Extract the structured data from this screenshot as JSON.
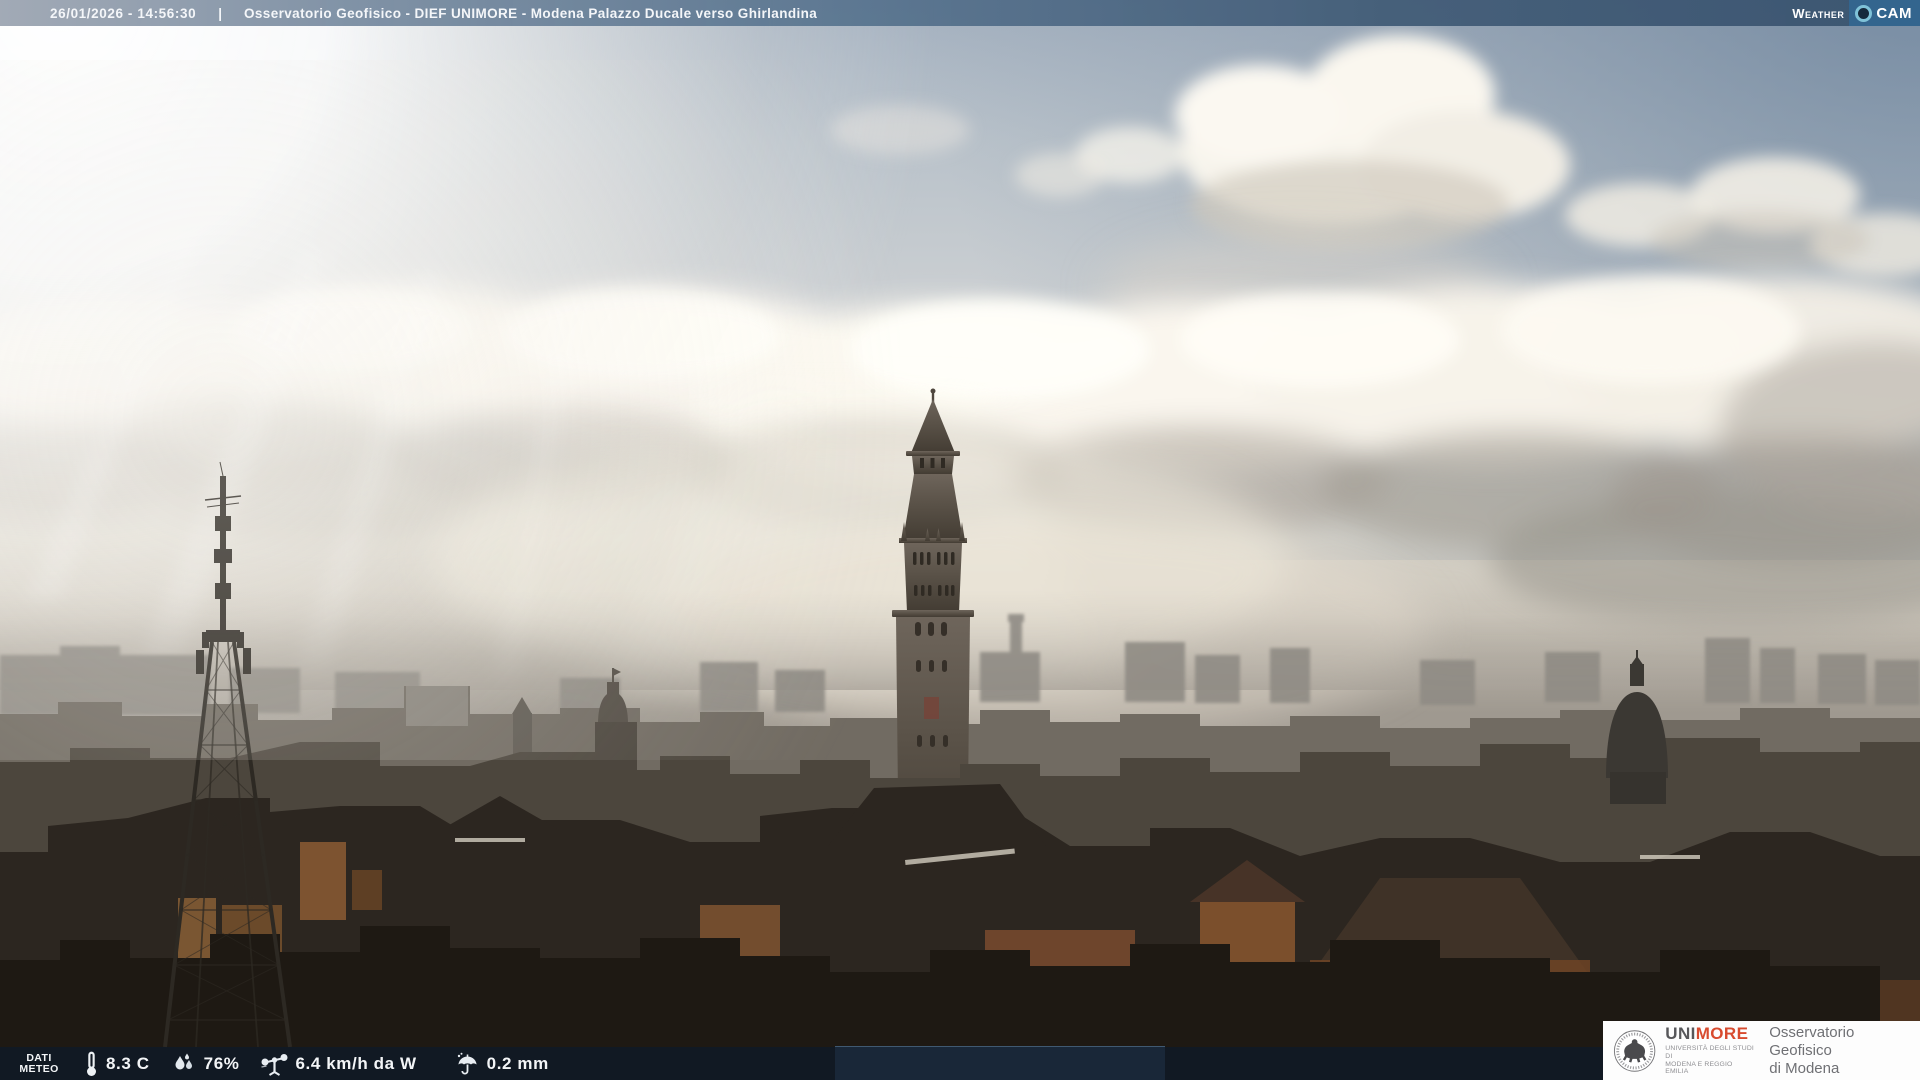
{
  "topbar": {
    "datetime": "26/01/2026 - 14:56:30",
    "separator": "|",
    "title": "Osservatorio Geofisico - DIEF UNIMORE - Modena Palazzo Ducale verso Ghirlandina",
    "logo": {
      "weather": "Weather",
      "cam": "CAM",
      "lens_icon": "camera-lens-icon"
    }
  },
  "meteo_bar": {
    "label_line1": "DATI",
    "label_line2": "METEO",
    "readings": [
      {
        "name": "temperature",
        "icon": "thermometer-icon",
        "value": "8.3 C"
      },
      {
        "name": "humidity",
        "icon": "humidity-drops-icon",
        "value": "76%"
      },
      {
        "name": "wind",
        "icon": "anemometer-icon",
        "value": "6.4 km/h da W"
      },
      {
        "name": "rain",
        "icon": "umbrella-rain-icon",
        "value": "0.2 mm"
      }
    ]
  },
  "branding": {
    "seal_icon": "unimore-seal-icon",
    "wordmark_uni": "UNI",
    "wordmark_more": "MORE",
    "university_line1": "UNIVERSITÀ DEGLI STUDI DI",
    "university_line2": "MODENA E REGGIO EMILIA",
    "org_line1": "Osservatorio Geofisico",
    "org_line2": "di Modena"
  },
  "scene": {
    "description": "Backlit afternoon webcam view over Modena rooftops toward the Ghirlandina tower, telecom lattice mast at left, cumulus band and sun glare at top left",
    "landmarks": [
      "antenna-tower",
      "ghirlandina-tower",
      "church-dome-left",
      "church-dome-right"
    ]
  },
  "colors": {
    "topbar_left": "#9aa3b0",
    "topbar_right": "#3a5470",
    "cam_panel": "#33658e",
    "lens_ring": "#7fc2d8",
    "meteo_bar_overlay": "rgba(14,26,40,0.78)",
    "unimore_red": "#d84b2f",
    "unimore_gray": "#57575a"
  }
}
